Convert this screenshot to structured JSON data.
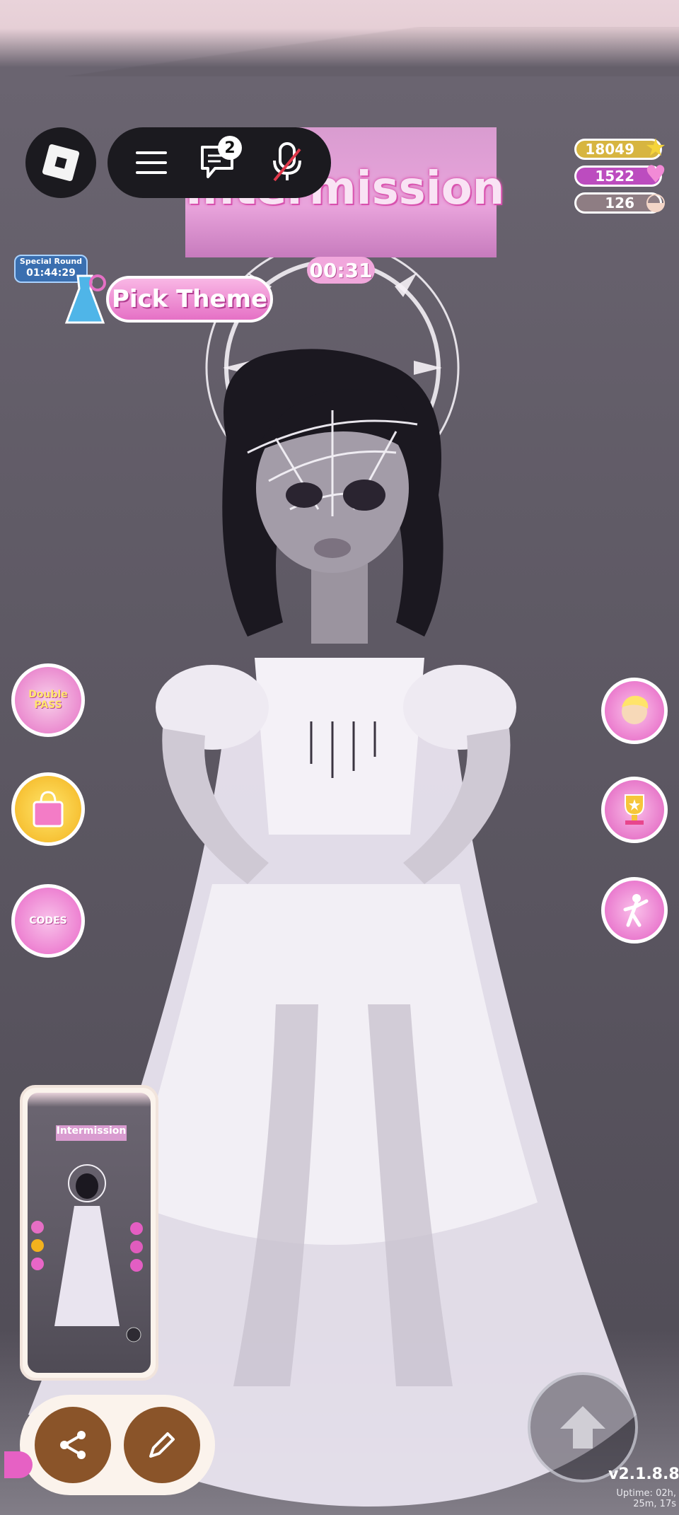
{
  "topbar": {
    "chat_badge": "2"
  },
  "banner": {
    "title": "Intermission",
    "timer": "00:31"
  },
  "currency": {
    "stars": "18049",
    "hearts": "1522",
    "shells": "126"
  },
  "special_round": {
    "label": "Special Round",
    "time": "01:44:29"
  },
  "pick_theme": {
    "label": "Pick Theme"
  },
  "side_buttons": {
    "left1_label": "Double PASS",
    "left3_label": "CODES"
  },
  "thumbnail": {
    "title": "Intermission"
  },
  "footer": {
    "version": "v2.1.8.8",
    "uptime_line1": "Uptime: 02h,",
    "uptime_line2": "25m, 17s"
  },
  "colors": {
    "accent_pink": "#e570c5",
    "button_brown": "#8a5429",
    "bar_dark": "#1b1a1f"
  }
}
